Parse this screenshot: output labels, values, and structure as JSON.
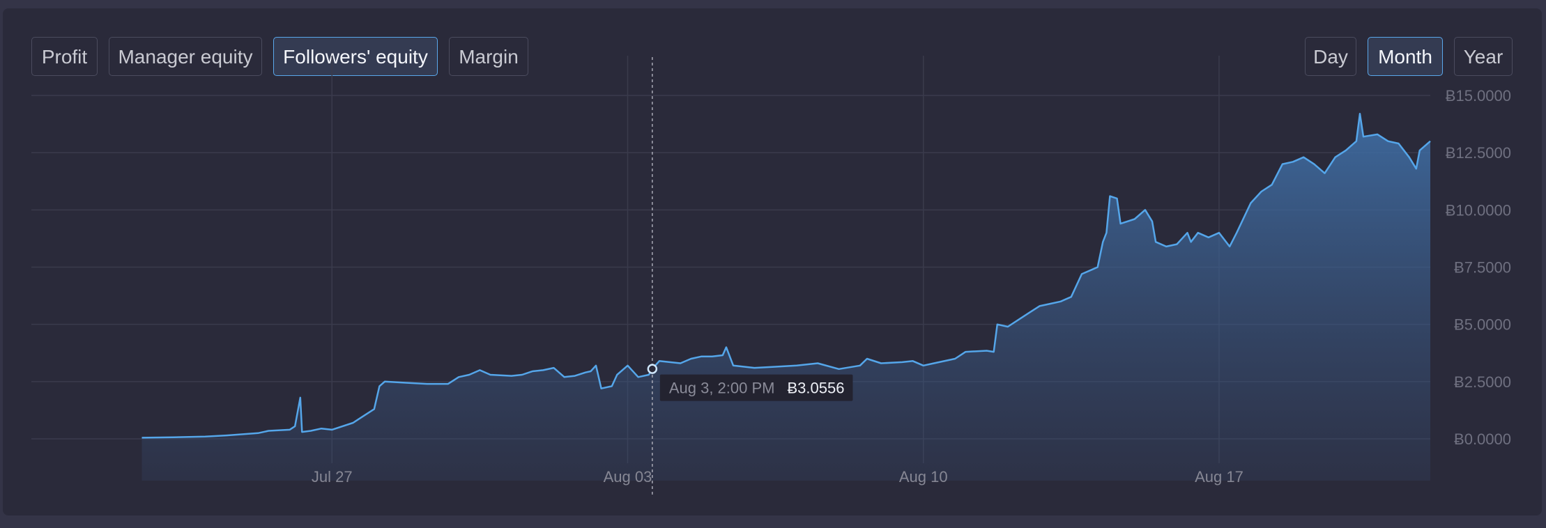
{
  "tabs": [
    {
      "label": "Profit",
      "active": false
    },
    {
      "label": "Manager equity",
      "active": false
    },
    {
      "label": "Followers' equity",
      "active": true
    },
    {
      "label": "Margin",
      "active": false
    }
  ],
  "periods": [
    {
      "label": "Day",
      "active": false
    },
    {
      "label": "Month",
      "active": true
    },
    {
      "label": "Year",
      "active": false
    }
  ],
  "colors": {
    "accent": "#5aa8ec",
    "line": "#55a6ea",
    "panel": "#2a2a3a"
  },
  "tooltip": {
    "date": "Aug 3, 2:00 PM",
    "value": "Ƀ3.0556"
  },
  "chart_data": {
    "type": "area",
    "ylim": [
      0,
      15
    ],
    "xlim": [
      "2025-07-20",
      "2025-08-22"
    ],
    "y_ticks": [
      {
        "value": 15,
        "label": "Ƀ15.0000"
      },
      {
        "value": 12.5,
        "label": "Ƀ12.5000"
      },
      {
        "value": 10,
        "label": "Ƀ10.0000"
      },
      {
        "value": 7.5,
        "label": "Ƀ7.5000"
      },
      {
        "value": 5,
        "label": "Ƀ5.0000"
      },
      {
        "value": 2.5,
        "label": "Ƀ2.5000"
      },
      {
        "value": 0,
        "label": "Ƀ0.0000"
      }
    ],
    "x_ticks": [
      {
        "date": "2025-07-27",
        "label": "Jul 27"
      },
      {
        "date": "2025-08-03",
        "label": "Aug 03"
      },
      {
        "date": "2025-08-10",
        "label": "Aug 10"
      },
      {
        "date": "2025-08-17",
        "label": "Aug 17"
      }
    ],
    "grid": true,
    "highlight": {
      "date": "2025-08-03 14:00",
      "value": 3.0556
    },
    "series": [
      {
        "points": [
          [
            "2025-07-22 12:00",
            0.05
          ],
          [
            "2025-07-23 06:00",
            0.07
          ],
          [
            "2025-07-24 00:00",
            0.1
          ],
          [
            "2025-07-24 12:00",
            0.15
          ],
          [
            "2025-07-25 06:00",
            0.25
          ],
          [
            "2025-07-25 12:00",
            0.35
          ],
          [
            "2025-07-26 00:00",
            0.4
          ],
          [
            "2025-07-26 03:00",
            0.55
          ],
          [
            "2025-07-26 06:00",
            1.8
          ],
          [
            "2025-07-26 07:00",
            0.3
          ],
          [
            "2025-07-26 12:00",
            0.35
          ],
          [
            "2025-07-26 18:00",
            0.45
          ],
          [
            "2025-07-27 00:00",
            0.4
          ],
          [
            "2025-07-27 12:00",
            0.7
          ],
          [
            "2025-07-27 18:00",
            1.0
          ],
          [
            "2025-07-28 00:00",
            1.3
          ],
          [
            "2025-07-28 03:00",
            2.3
          ],
          [
            "2025-07-28 06:00",
            2.5
          ],
          [
            "2025-07-28 18:00",
            2.45
          ],
          [
            "2025-07-29 06:00",
            2.4
          ],
          [
            "2025-07-29 18:00",
            2.4
          ],
          [
            "2025-07-30 00:00",
            2.7
          ],
          [
            "2025-07-30 06:00",
            2.8
          ],
          [
            "2025-07-30 12:00",
            3.0
          ],
          [
            "2025-07-30 18:00",
            2.8
          ],
          [
            "2025-07-31 06:00",
            2.75
          ],
          [
            "2025-07-31 12:00",
            2.8
          ],
          [
            "2025-07-31 18:00",
            2.95
          ],
          [
            "2025-08-01 00:00",
            3.0
          ],
          [
            "2025-08-01 06:00",
            3.1
          ],
          [
            "2025-08-01 12:00",
            2.7
          ],
          [
            "2025-08-01 18:00",
            2.75
          ],
          [
            "2025-08-02 00:00",
            2.9
          ],
          [
            "2025-08-02 03:00",
            2.95
          ],
          [
            "2025-08-02 06:00",
            3.2
          ],
          [
            "2025-08-02 09:00",
            2.2
          ],
          [
            "2025-08-02 15:00",
            2.3
          ],
          [
            "2025-08-02 18:00",
            2.8
          ],
          [
            "2025-08-03 00:00",
            3.2
          ],
          [
            "2025-08-03 06:00",
            2.7
          ],
          [
            "2025-08-03 12:00",
            2.8
          ],
          [
            "2025-08-03 14:00",
            3.0556
          ],
          [
            "2025-08-03 18:00",
            3.4
          ],
          [
            "2025-08-04 06:00",
            3.3
          ],
          [
            "2025-08-04 12:00",
            3.5
          ],
          [
            "2025-08-04 18:00",
            3.6
          ],
          [
            "2025-08-05 00:00",
            3.6
          ],
          [
            "2025-08-05 06:00",
            3.65
          ],
          [
            "2025-08-05 08:00",
            4.0
          ],
          [
            "2025-08-05 12:00",
            3.2
          ],
          [
            "2025-08-06 00:00",
            3.1
          ],
          [
            "2025-08-06 12:00",
            3.15
          ],
          [
            "2025-08-07 00:00",
            3.2
          ],
          [
            "2025-08-07 12:00",
            3.3
          ],
          [
            "2025-08-08 00:00",
            3.05
          ],
          [
            "2025-08-08 12:00",
            3.2
          ],
          [
            "2025-08-08 16:00",
            3.5
          ],
          [
            "2025-08-09 00:00",
            3.3
          ],
          [
            "2025-08-09 12:00",
            3.35
          ],
          [
            "2025-08-09 18:00",
            3.4
          ],
          [
            "2025-08-10 00:00",
            3.2
          ],
          [
            "2025-08-10 06:00",
            3.3
          ],
          [
            "2025-08-10 18:00",
            3.5
          ],
          [
            "2025-08-11 00:00",
            3.8
          ],
          [
            "2025-08-11 12:00",
            3.85
          ],
          [
            "2025-08-11 16:00",
            3.8
          ],
          [
            "2025-08-11 18:00",
            5.0
          ],
          [
            "2025-08-12 00:00",
            4.9
          ],
          [
            "2025-08-12 06:00",
            5.2
          ],
          [
            "2025-08-12 12:00",
            5.5
          ],
          [
            "2025-08-12 18:00",
            5.8
          ],
          [
            "2025-08-13 00:00",
            5.9
          ],
          [
            "2025-08-13 06:00",
            6.0
          ],
          [
            "2025-08-13 12:00",
            6.2
          ],
          [
            "2025-08-13 18:00",
            7.2
          ],
          [
            "2025-08-14 00:00",
            7.4
          ],
          [
            "2025-08-14 03:00",
            7.5
          ],
          [
            "2025-08-14 06:00",
            8.6
          ],
          [
            "2025-08-14 08:00",
            9.0
          ],
          [
            "2025-08-14 10:00",
            10.6
          ],
          [
            "2025-08-14 14:00",
            10.5
          ],
          [
            "2025-08-14 16:00",
            9.4
          ],
          [
            "2025-08-15 00:00",
            9.6
          ],
          [
            "2025-08-15 06:00",
            10.0
          ],
          [
            "2025-08-15 10:00",
            9.5
          ],
          [
            "2025-08-15 12:00",
            8.6
          ],
          [
            "2025-08-15 18:00",
            8.4
          ],
          [
            "2025-08-16 00:00",
            8.5
          ],
          [
            "2025-08-16 06:00",
            9.0
          ],
          [
            "2025-08-16 08:00",
            8.6
          ],
          [
            "2025-08-16 12:00",
            9.0
          ],
          [
            "2025-08-16 18:00",
            8.8
          ],
          [
            "2025-08-17 00:00",
            9.0
          ],
          [
            "2025-08-17 06:00",
            8.4
          ],
          [
            "2025-08-17 10:00",
            9.0
          ],
          [
            "2025-08-17 18:00",
            10.3
          ],
          [
            "2025-08-18 00:00",
            10.8
          ],
          [
            "2025-08-18 06:00",
            11.1
          ],
          [
            "2025-08-18 12:00",
            12.0
          ],
          [
            "2025-08-18 18:00",
            12.1
          ],
          [
            "2025-08-19 00:00",
            12.3
          ],
          [
            "2025-08-19 06:00",
            12.0
          ],
          [
            "2025-08-19 12:00",
            11.6
          ],
          [
            "2025-08-19 18:00",
            12.3
          ],
          [
            "2025-08-20 00:00",
            12.6
          ],
          [
            "2025-08-20 06:00",
            13.0
          ],
          [
            "2025-08-20 08:00",
            14.2
          ],
          [
            "2025-08-20 10:00",
            13.2
          ],
          [
            "2025-08-20 18:00",
            13.3
          ],
          [
            "2025-08-21 00:00",
            13.0
          ],
          [
            "2025-08-21 06:00",
            12.9
          ],
          [
            "2025-08-21 12:00",
            12.3
          ],
          [
            "2025-08-21 16:00",
            11.8
          ],
          [
            "2025-08-21 18:00",
            12.6
          ],
          [
            "2025-08-22 00:00",
            13.0
          ]
        ]
      }
    ]
  }
}
